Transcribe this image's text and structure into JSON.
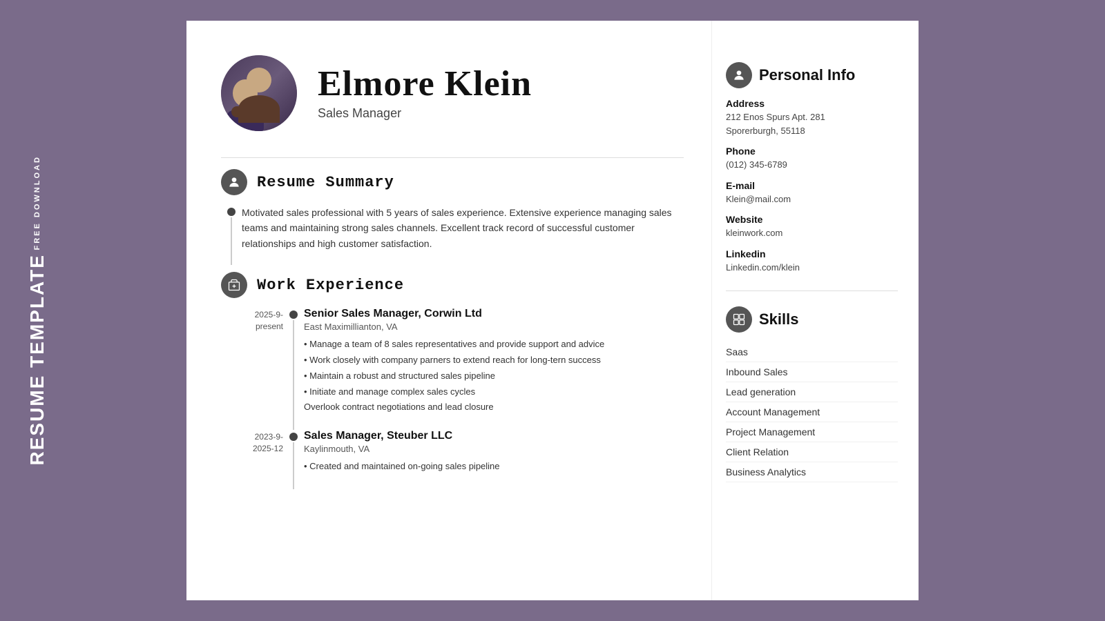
{
  "sideLabel": {
    "freeDownload": "FREE DOWNLOAD",
    "resumeTemplate": "RESUME TEMPLATE"
  },
  "header": {
    "name": "Elmore Klein",
    "title": "Sales Manager"
  },
  "sections": {
    "summary": {
      "title": "Resume Summary",
      "text": "Motivated sales professional with 5 years of sales experience. Extensive experience managing sales teams and maintaining strong sales channels. Excellent track record of successful customer relationships and high customer satisfaction."
    },
    "workExperience": {
      "title": "Work Experience",
      "jobs": [
        {
          "dateStart": "2025-9-",
          "dateEnd": "present",
          "title": "Senior Sales Manager, Corwin Ltd",
          "location": "East Maximillianton, VA",
          "bullets": [
            "• Manage a team of 8 sales representatives and provide support and advice",
            "• Work closely with company parners to extend reach for long-tern success",
            "• Maintain a robust and structured sales pipeline",
            "• Initiate and manage complex sales cycles",
            "Overlook contract negotiations and lead closure"
          ]
        },
        {
          "dateStart": "2023-9-",
          "dateEnd": "2025-12",
          "title": "Sales Manager, Steuber LLC",
          "location": "Kaylinmouth, VA",
          "bullets": [
            "• Created and maintained on-going sales pipeline"
          ]
        }
      ]
    }
  },
  "sidebar": {
    "personalInfo": {
      "title": "Personal Info",
      "fields": [
        {
          "label": "Address",
          "value": "212 Enos Spurs Apt. 281\nSporerburgh, 55118"
        },
        {
          "label": "Phone",
          "value": "(012) 345-6789"
        },
        {
          "label": "E-mail",
          "value": "Klein@mail.com"
        },
        {
          "label": "Website",
          "value": "kleinwork.com"
        },
        {
          "label": "Linkedin",
          "value": "Linkedin.com/klein"
        }
      ]
    },
    "skills": {
      "title": "Skills",
      "items": [
        "Saas",
        "Inbound Sales",
        "Lead generation",
        "Account Management",
        "Project Management",
        "Client Relation",
        "Business Analytics"
      ]
    }
  }
}
